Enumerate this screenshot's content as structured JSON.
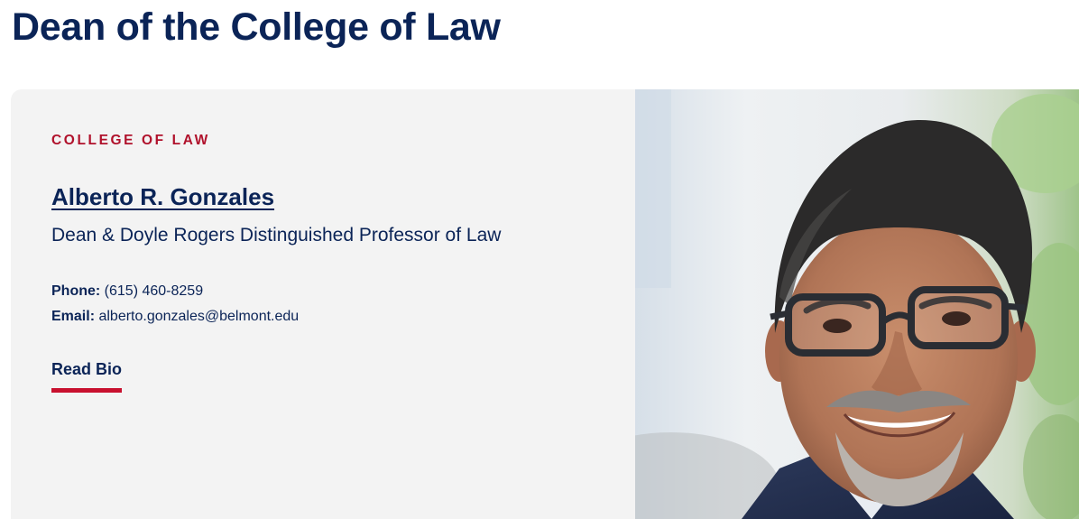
{
  "page": {
    "title": "Dean of the College of Law"
  },
  "profile": {
    "eyebrow": "COLLEGE OF LAW",
    "name": "Alberto R. Gonzales",
    "job_title": "Dean & Doyle Rogers Distinguished Professor of Law",
    "phone_label": "Phone:",
    "phone_value": "(615) 460-8259",
    "email_label": "Email:",
    "email_value": "alberto.gonzales@belmont.edu",
    "read_bio_label": "Read Bio"
  },
  "colors": {
    "navy": "#0b2457",
    "accent_red": "#c8102e",
    "card_bg": "#f3f3f3"
  }
}
